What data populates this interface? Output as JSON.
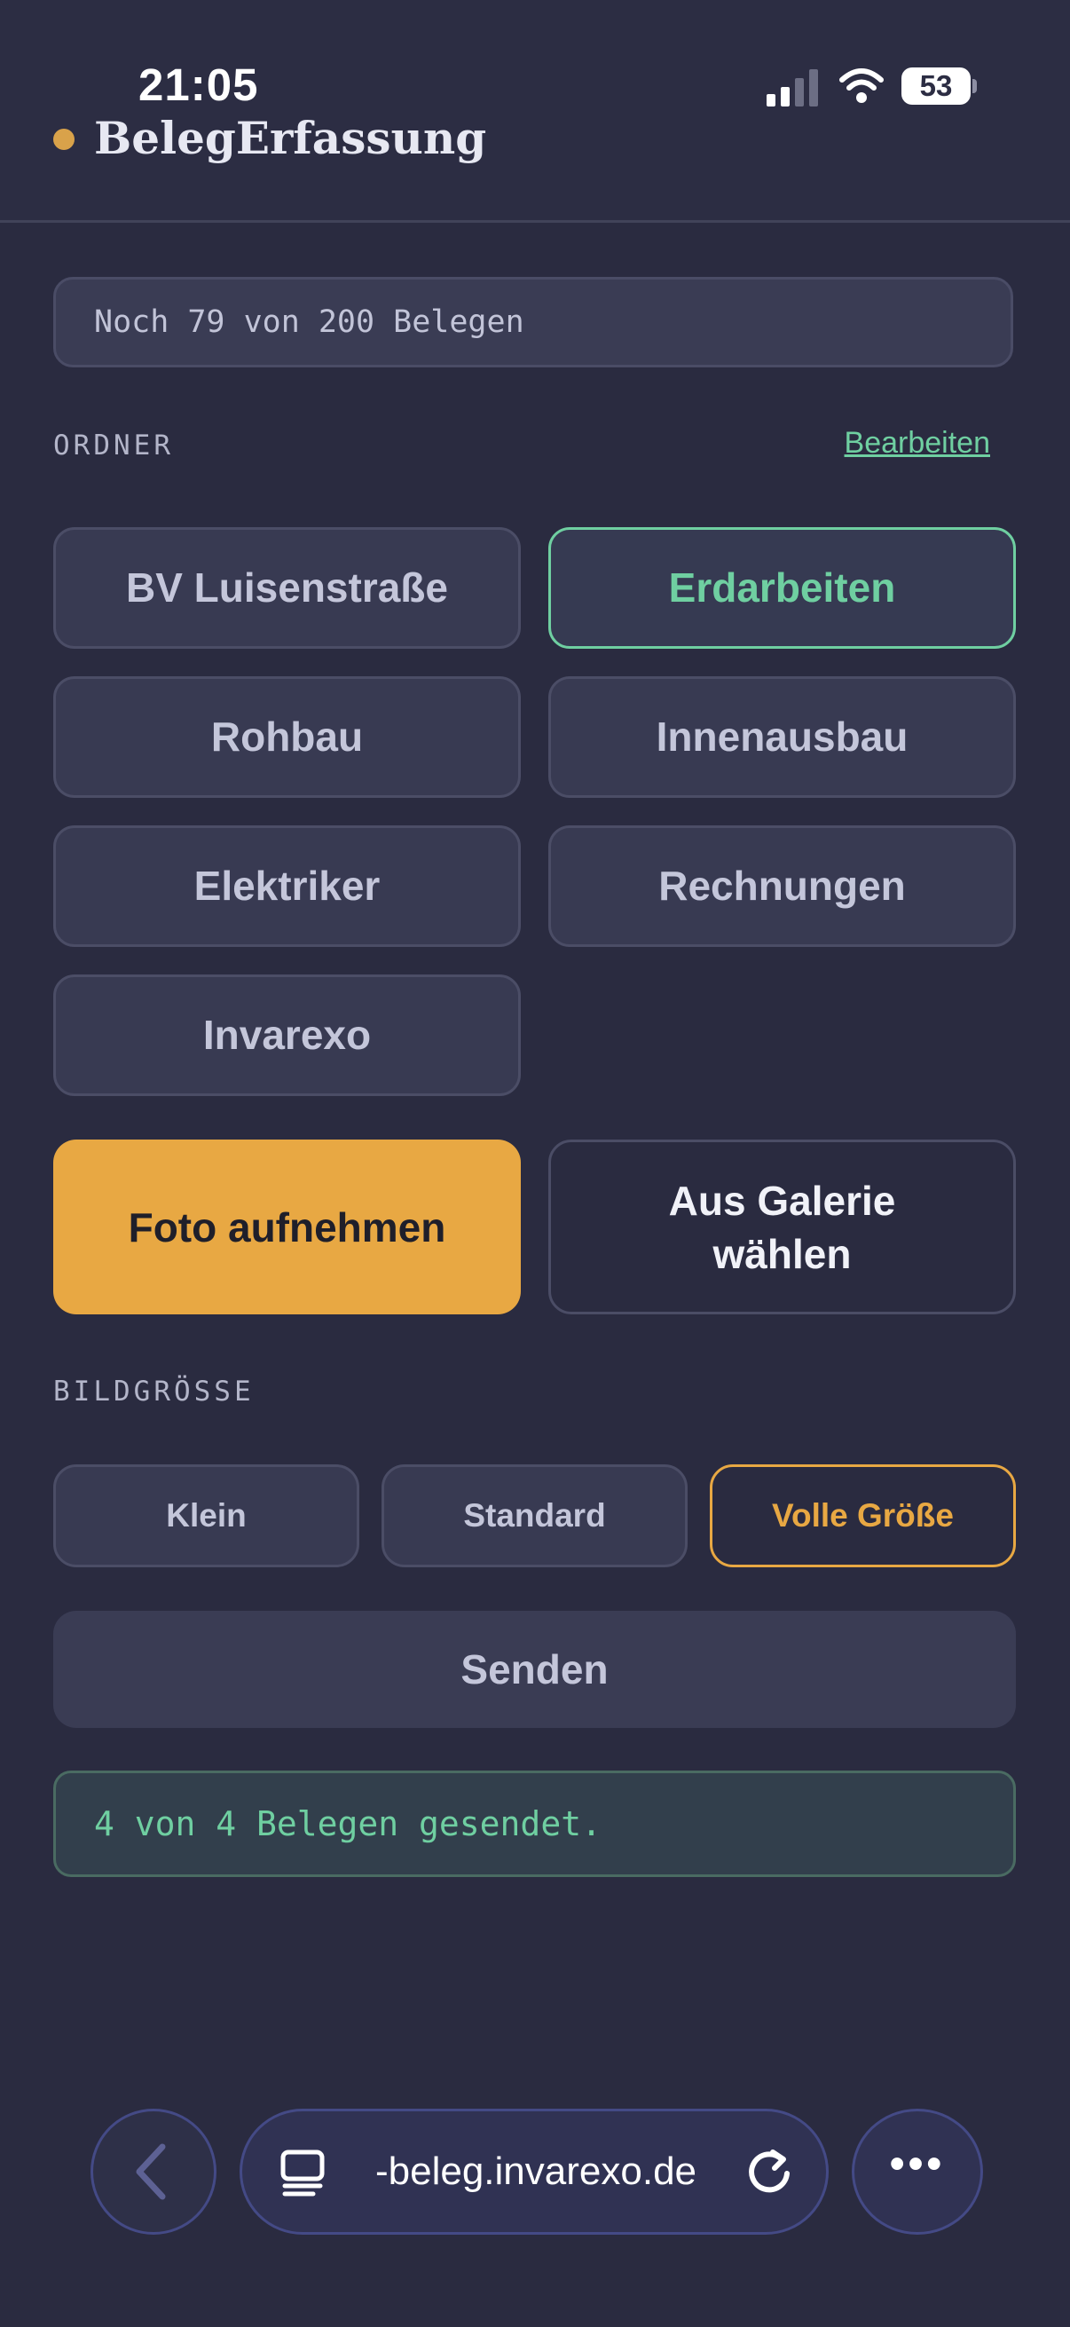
{
  "status_bar": {
    "time": "21:05",
    "battery": "53"
  },
  "app": {
    "title": "BelegErfassung"
  },
  "quota": {
    "text": "Noch 79 von 200 Belegen"
  },
  "folders": {
    "label": "ORDNER",
    "edit_label": "Bearbeiten",
    "items": [
      {
        "label": "BV Luisenstraße",
        "active": false
      },
      {
        "label": "Erdarbeiten",
        "active": true
      },
      {
        "label": "Rohbau",
        "active": false
      },
      {
        "label": "Innenausbau",
        "active": false
      },
      {
        "label": "Elektriker",
        "active": false
      },
      {
        "label": "Rechnungen",
        "active": false
      },
      {
        "label": "Invarexo",
        "active": false
      }
    ]
  },
  "capture": {
    "photo_label": "Foto aufnehmen",
    "gallery_label_line1": "Aus Galerie",
    "gallery_label_line2": "wählen"
  },
  "image_size": {
    "label": "BILDGRÖSSE",
    "options": [
      "Klein",
      "Standard",
      "Volle Größe"
    ],
    "selected": "Volle Größe"
  },
  "send": {
    "label": "Senden"
  },
  "status": {
    "text": "4 von 4 Belegen gesendet."
  },
  "browser": {
    "url": "-beleg.invarexo.de",
    "more_label": "•••"
  },
  "colors": {
    "accent": "#e8a843",
    "success": "#6fcfa1",
    "background": "#2a2b40"
  }
}
